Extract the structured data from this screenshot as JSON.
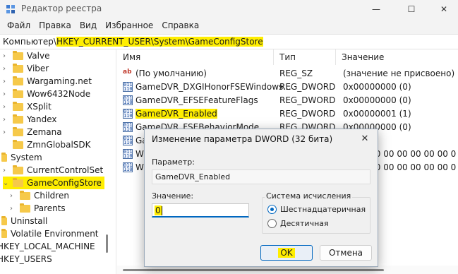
{
  "window": {
    "title": "Редактор реестра",
    "minimize_glyph": "—",
    "maximize_glyph": "☐",
    "close_glyph": "✕"
  },
  "menu": [
    "Файл",
    "Правка",
    "Вид",
    "Избранное",
    "Справка"
  ],
  "address": {
    "prefix": "Компьютер\\",
    "highlighted_path": "HKEY_CURRENT_USER\\System\\GameConfigStore"
  },
  "tree": {
    "items": [
      {
        "label": "Valve",
        "chevron": "›"
      },
      {
        "label": "Viber",
        "chevron": "›"
      },
      {
        "label": "Wargaming.net",
        "chevron": "›"
      },
      {
        "label": "Wow6432Node",
        "chevron": "›"
      },
      {
        "label": "XSplit",
        "chevron": "›"
      },
      {
        "label": "Yandex",
        "chevron": "›"
      },
      {
        "label": "Zemana",
        "chevron": "›"
      },
      {
        "label": "ZmnGlobalSDK",
        "chevron": ""
      },
      {
        "label": "System",
        "chevron": "⌄"
      },
      {
        "label": "CurrentControlSet",
        "chevron": "›"
      },
      {
        "label": "GameConfigStore",
        "chevron": "⌄"
      },
      {
        "label": "Children",
        "chevron": "›"
      },
      {
        "label": "Parents",
        "chevron": "›"
      },
      {
        "label": "Uninstall",
        "chevron": ""
      },
      {
        "label": "Volatile Environment",
        "chevron": ""
      },
      {
        "label": "HKEY_LOCAL_MACHINE",
        "chevron": ""
      },
      {
        "label": "HKEY_USERS",
        "chevron": ""
      }
    ],
    "selected": "GameConfigStore"
  },
  "list": {
    "columns": [
      "Имя",
      "Тип",
      "Значение"
    ],
    "rows": [
      {
        "icon": "string-value-icon",
        "name": "(По умолчанию)",
        "type": "REG_SZ",
        "value": "(значение не присвоено)"
      },
      {
        "icon": "dword-value-icon",
        "name": "GameDVR_DXGIHonorFSEWindows...",
        "type": "REG_DWORD",
        "value": "0x00000000 (0)"
      },
      {
        "icon": "dword-value-icon",
        "name": "GameDVR_EFSEFeatureFlags",
        "type": "REG_DWORD",
        "value": "0x00000000 (0)"
      },
      {
        "icon": "dword-value-icon",
        "name": "GameDVR_Enabled",
        "type": "REG_DWORD",
        "value": "0x00000001 (1)"
      },
      {
        "icon": "dword-value-icon",
        "name": "GameDVR_FSEBehaviorMode",
        "type": "REG_DWORD",
        "value": "0x00000000 (0)"
      },
      {
        "icon": "dword-value-icon",
        "name": "Ga",
        "type": "",
        "value": ""
      },
      {
        "icon": "dword-value-icon",
        "name": "Wi",
        "type": "",
        "value": "00 00 00 00 00 00 00 00 0"
      },
      {
        "icon": "dword-value-icon",
        "name": "Wi",
        "type": "",
        "value": "00 00 00 00 00 00 00 00 0"
      }
    ],
    "highlighted_row": "GameDVR_Enabled"
  },
  "dialog": {
    "title": "Изменение параметра DWORD (32 бита)",
    "close_glyph": "✕",
    "param_label": "Параметр:",
    "param_value": "GameDVR_Enabled",
    "value_label": "Значение:",
    "value": "0",
    "base_label": "Система исчисления",
    "base_options": [
      {
        "label": "Шестнадцатеричная",
        "selected": true
      },
      {
        "label": "Десятичная",
        "selected": false
      }
    ],
    "ok_label": "OK",
    "cancel_label": "Отмена"
  },
  "colors": {
    "highlight": "#ffee00",
    "accent": "#0067c0",
    "folder": "#f6c94a"
  }
}
